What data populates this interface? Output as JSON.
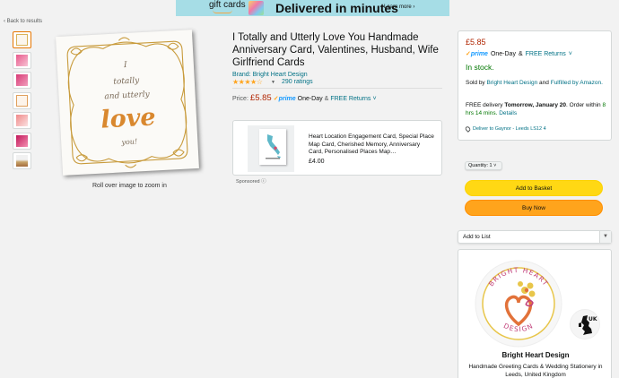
{
  "banner": {
    "gift_cards": "gift cards",
    "headline": "Delivered in minutes",
    "learn_more": "Learn more ›"
  },
  "nav": {
    "back": "‹ Back to results"
  },
  "gallery": {
    "thumbnails": [
      "thumb-1",
      "thumb-2",
      "thumb-3",
      "thumb-4",
      "thumb-5",
      "thumb-6",
      "thumb-7"
    ],
    "rollover_text": "Roll over image to zoom in",
    "card_words": {
      "line1": "I",
      "line2": "totally",
      "line3": "and utterly",
      "line4": "love",
      "line5": "you!"
    }
  },
  "product": {
    "title": "I Totally and Utterly Love You Handmade Anniversary Card, Valentines, Husband, Wife Girlfriend Cards",
    "brand": "Brand: Bright Heart Design",
    "rating_stars": "★★★★☆",
    "rating_value": 4.5,
    "ratings_count": "290 ratings",
    "price_label": "Price:",
    "price": "£5.85",
    "prime": "prime",
    "one_day": "One-Day",
    "amp": "&",
    "free_returns": "FREE Returns"
  },
  "sponsored": {
    "title": "Heart Location Engagement Card, Special Place Map Card, Cherished Memory, Anniversary Card, Personalised Places Map…",
    "price": "£4.00",
    "label": "Sponsored ⓘ"
  },
  "buybox": {
    "price": "£5.85",
    "prime": "prime",
    "one_day": "One-Day",
    "amp": "&",
    "free_returns": "FREE Returns",
    "stock": "In stock.",
    "sold_by_prefix": "Sold by",
    "seller": "Bright Heart Design",
    "and": "and",
    "fulfilled": "Fulfilled by Amazon.",
    "delivery_prefix": "FREE delivery",
    "delivery_date": "Tomorrow, January 20",
    "order_within": ". Order within",
    "countdown": "8 hrs 14 mins.",
    "details": "Details",
    "deliver_to": "Deliver to Gaynor - Leeds LS12 4",
    "quantity": "Quantity: 1",
    "add_to_basket": "Add to Basket",
    "buy_now": "Buy Now",
    "add_to_list": "Add to List"
  },
  "brand_card": {
    "logo_top": "BRIGHT HEART",
    "logo_bottom": "DESIGN",
    "uk_badge": "UK",
    "name": "Bright Heart Design",
    "description": "Handmade Greeting Cards & Wedding Stationery in Leeds, United Kingdom"
  },
  "colors": {
    "price_red": "#b12704",
    "link_teal": "#007185",
    "stock_green": "#007600",
    "star_orange": "#ffa41c",
    "basket_yellow": "#ffd814",
    "buy_orange": "#ffa41c",
    "prime_blue": "#1399ff"
  }
}
